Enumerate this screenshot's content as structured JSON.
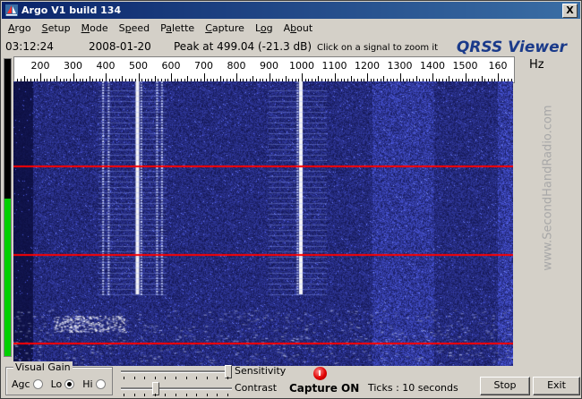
{
  "window": {
    "title": "Argo V1 build 134",
    "close_label": "X"
  },
  "menu": [
    {
      "pre": "",
      "u": "A",
      "post": "rgo"
    },
    {
      "pre": "",
      "u": "S",
      "post": "etup"
    },
    {
      "pre": "",
      "u": "M",
      "post": "ode"
    },
    {
      "pre": "S",
      "u": "p",
      "post": "eed"
    },
    {
      "pre": "P",
      "u": "a",
      "post": "lette"
    },
    {
      "pre": "",
      "u": "C",
      "post": "apture"
    },
    {
      "pre": "L",
      "u": "o",
      "post": "g"
    },
    {
      "pre": "A",
      "u": "b",
      "post": "out"
    }
  ],
  "info": {
    "time": "03:12:24",
    "date": "2008-01-20",
    "peak": "Peak at  499.04 (-21.3 dB)",
    "hint": "Click on a signal to zoom it",
    "brand": "QRSS Viewer"
  },
  "scale": {
    "labels": [
      "200",
      "300",
      "400",
      "500",
      "600",
      "700",
      "800",
      "900",
      "1000",
      "1100",
      "1200",
      "1300",
      "1400",
      "1500",
      "160"
    ],
    "unit": "Hz"
  },
  "watermark": "www.SecondHandRadio.com",
  "spectrogram": {
    "red_lines_frac": [
      0.297,
      0.607,
      0.917
    ],
    "carriers_hz": [
      395,
      412,
      500,
      512,
      560,
      575,
      990,
      1000
    ]
  },
  "level_meter": {
    "fill": 0.53
  },
  "controls": {
    "visual_gain": "Visual Gain",
    "agc": "Agc",
    "lo": "Lo",
    "hi": "Hi",
    "selected": "lo",
    "sensitivity_label": "Sensitivity",
    "contrast_label": "Contrast",
    "sensitivity_value": 1.0,
    "contrast_value": 0.3,
    "capture": "Capture ON",
    "ticks": "Ticks   : 10 seconds",
    "stop": "Stop",
    "exit": "Exit"
  },
  "colors": {
    "title_start": "#0a246a",
    "title_end": "#3a6ea5",
    "red_line": "#ff0000",
    "spec_bg": "#060a3a",
    "brand": "#1a3a8a"
  }
}
